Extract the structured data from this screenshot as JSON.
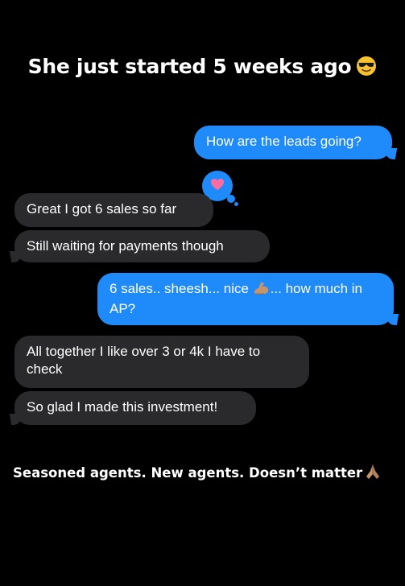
{
  "headline": {
    "text": "She just started 5 weeks ago",
    "emoji": "smiling-face-with-sunglasses-icon"
  },
  "messages": [
    {
      "direction": "outgoing",
      "text": "How are the leads going?"
    },
    {
      "direction": "incoming",
      "text": "Great I got 6 sales so far",
      "tapback": "heart-icon"
    },
    {
      "direction": "incoming",
      "text": "Still waiting for payments though"
    },
    {
      "direction": "outgoing",
      "text_before": "6 sales.. sheesh... nice",
      "emoji": "flexed-biceps-icon",
      "text_after": "... how much in AP?"
    },
    {
      "direction": "incoming",
      "text": "All together I like over 3 or 4k I have to check"
    },
    {
      "direction": "incoming",
      "text": "So glad I made this investment!"
    }
  ],
  "caption": {
    "text": "Seasoned agents. New agents. Doesn’t matter",
    "emoji": "folded-hands-icon"
  },
  "colors": {
    "background": "#000000",
    "outgoing_bubble": "#1f8bfa",
    "incoming_bubble": "#2a2a2c",
    "heart": "#ff6b9e"
  }
}
